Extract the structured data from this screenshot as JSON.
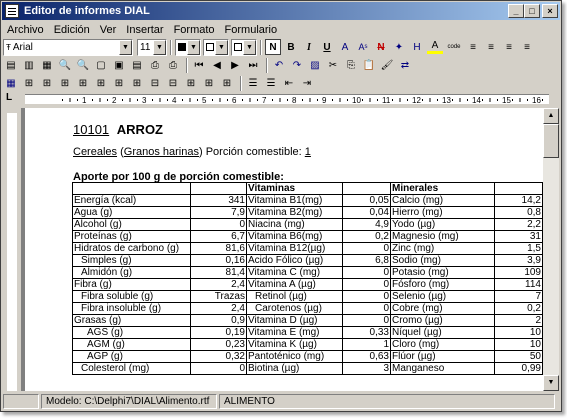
{
  "window": {
    "title": "Editor de informes DIAL"
  },
  "title_buttons": {
    "minimize": "_",
    "maximize": "□",
    "close": "×"
  },
  "menu": [
    "Archivo",
    "Edición",
    "Ver",
    "Insertar",
    "Formato",
    "Formulario"
  ],
  "format_bar": {
    "font_name": "Arial",
    "font_size": "11",
    "bold": "B",
    "italic": "I",
    "underline": "U",
    "superscript": "A",
    "highlight": "H",
    "font_color": "A",
    "code": "code"
  },
  "document": {
    "food_code": "10101",
    "food_name": "ARROZ",
    "category": "Cereales",
    "subcategory": "Granos harinas",
    "portion_label": "Porción comestible:",
    "portion_value": "1",
    "section_title": "Aporte por 100 g de porción comestible:",
    "col_vitaminas": "Vitaminas",
    "col_minerales": "Minerales",
    "rows": [
      [
        "Energía (kcal)",
        "341",
        "Vitamina B1(mg)",
        "0,05",
        "Calcio (mg)",
        "14,2"
      ],
      [
        "Agua (g)",
        "7,9",
        "Vitamina B2(mg)",
        "0,04",
        "Hierro (mg)",
        "0,8"
      ],
      [
        "Alcohol (g)",
        "0",
        "Niacina (mg)",
        "4,9",
        "Yodo (µg)",
        "2,2"
      ],
      [
        "Proteínas (g)",
        "6,7",
        "Vitamina B6(mg)",
        "0,2",
        "Magnesio (mg)",
        "31"
      ],
      [
        "Hidratos de carbono (g)",
        "81,6",
        "Vitamina B12(µg)",
        "0",
        "Zinc (mg)",
        "1,5"
      ],
      [
        "Simples (g)",
        "0,16",
        "Acido Fólico (µg)",
        "6,8",
        "Sodio (mg)",
        "3,9"
      ],
      [
        "Almidón (g)",
        "81,4",
        "Vitamina C (mg)",
        "0",
        "Potasio (mg)",
        "109"
      ],
      [
        "Fibra (g)",
        "2,4",
        "Vitamina A (µg)",
        "0",
        "Fósforo (mg)",
        "114"
      ],
      [
        "Fibra soluble (g)",
        "Trazas",
        "Retinol (µg)",
        "0",
        "Selenio (µg)",
        "7"
      ],
      [
        "Fibra insoluble (g)",
        "2,4",
        "Carotenos (µg)",
        "0",
        "Cobre (mg)",
        "0,2"
      ],
      [
        "Grasas (g)",
        "0,9",
        "Vitamina D (µg)",
        "0",
        "Cromo (µg)",
        "2"
      ],
      [
        "AGS (g)",
        "0,19",
        "Vitamina E (mg)",
        "0,33",
        "Níquel (µg)",
        "10"
      ],
      [
        "AGM (g)",
        "0,23",
        "Vitamina K (µg)",
        "1",
        "Cloro (mg)",
        "10"
      ],
      [
        "AGP (g)",
        "0,32",
        "Pantoténico (mg)",
        "0,63",
        "Flúor (µg)",
        "50"
      ],
      [
        "Colesterol (mg)",
        "0",
        "Biotina (µg)",
        "3",
        "Manganeso",
        "0,99"
      ]
    ]
  },
  "status": {
    "model_path": "Modelo: C:\\Delphi7\\DIAL\\Alimento.rtf",
    "record": "ALIMENTO"
  }
}
